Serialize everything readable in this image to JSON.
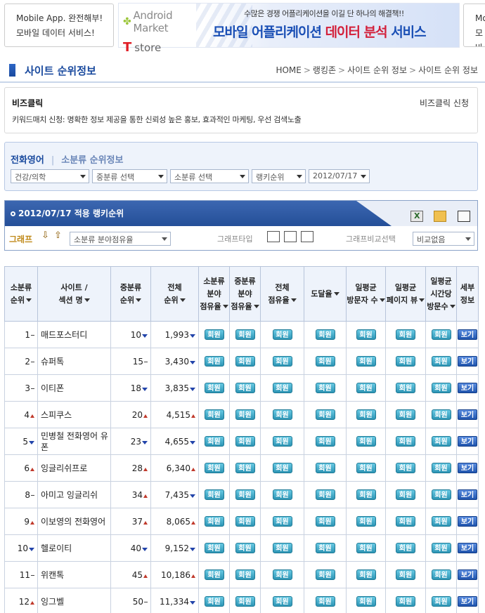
{
  "top_ads": {
    "left": {
      "line1": "Mobile App. 완전해부!",
      "line2": "모바일 데이터 서비스!"
    },
    "banner": {
      "brand1": "Android Market",
      "brand2_logo": "T",
      "brand2": "store",
      "subtitle": "수많은 경쟁 어플리케이션을 이길 단 하나의 해결책!!",
      "headline_a": "모바일 어플리케이션 ",
      "headline_b": "데이터 분석",
      "headline_c": " 서비스"
    },
    "right": {
      "line1": "Mob",
      "line2": "모바"
    }
  },
  "page_title": "사이트 순위정보",
  "breadcrumb": [
    "HOME",
    "랭킹존",
    "사이트 순위 정보",
    "사이트 순위 정보"
  ],
  "breadcrumb_sep": ">",
  "info": {
    "title": "비즈클릭",
    "link": "비즈클릭 신청",
    "desc": "키워드매치 신청: 명확한 정보 제공을 통한 신뢰성 높은 홍보, 효과적인 마케팅, 우선 검색노출"
  },
  "filter": {
    "category": "전화영어",
    "divider": "|",
    "sub_title": "소분류 순위정보",
    "selects": [
      "건강/의학",
      "중분류 선택",
      "소분류 선택",
      "랭키순위",
      "2012/07/17"
    ]
  },
  "ranking": {
    "title": "2012/07/17 적용 랭키순위",
    "graph_label": "그래프",
    "graph_arrow_down": "⇩",
    "graph_arrow_up": "⇧",
    "graph_select": "소분류 분야점유율",
    "graph_type_label": "그래프타입",
    "graph_compare_label": "그래프비교선택",
    "compare_select": "비교없음"
  },
  "table": {
    "headers": [
      [
        "소분류",
        "순위"
      ],
      [
        "사이트 /",
        "섹션 명"
      ],
      [
        "중분류",
        "순위"
      ],
      [
        "전체",
        "순위"
      ],
      [
        "소분류",
        "분야",
        "점유율"
      ],
      [
        "중분류",
        "분야",
        "점유율"
      ],
      [
        "전체",
        "점유율"
      ],
      [
        "도달율"
      ],
      [
        "일평균",
        "방문자 수"
      ],
      [
        "일평균",
        "페이지 뷰"
      ],
      [
        "일평균",
        "시간당",
        "방문수"
      ],
      [
        "세부",
        "정보"
      ]
    ],
    "member_label": "회원",
    "view_label": "보기",
    "rows": [
      {
        "rank": "1",
        "rmark": "eq",
        "name": "매드포스터디",
        "mid": "10",
        "mmark": "dn",
        "total": "1,993",
        "tmark": "dn"
      },
      {
        "rank": "2",
        "rmark": "eq",
        "name": "슈퍼톡",
        "mid": "15",
        "mmark": "eq",
        "total": "3,430",
        "tmark": "dn"
      },
      {
        "rank": "3",
        "rmark": "eq",
        "name": "이티폰",
        "mid": "18",
        "mmark": "dn",
        "total": "3,835",
        "tmark": "dn"
      },
      {
        "rank": "4",
        "rmark": "up",
        "name": "스피쿠스",
        "mid": "20",
        "mmark": "up",
        "total": "4,515",
        "tmark": "up"
      },
      {
        "rank": "5",
        "rmark": "dn",
        "name": "민병철 전화영어 유폰",
        "mid": "23",
        "mmark": "dn",
        "total": "4,655",
        "tmark": "dn"
      },
      {
        "rank": "6",
        "rmark": "up",
        "name": "잉글리쉬프로",
        "mid": "28",
        "mmark": "up",
        "total": "6,340",
        "tmark": "up"
      },
      {
        "rank": "8",
        "rmark": "eq",
        "name": "아미고 잉글리쉬",
        "mid": "34",
        "mmark": "up",
        "total": "7,435",
        "tmark": "dn"
      },
      {
        "rank": "9",
        "rmark": "up",
        "name": "이보영의 전화영어",
        "mid": "37",
        "mmark": "up",
        "total": "8,065",
        "tmark": "up"
      },
      {
        "rank": "10",
        "rmark": "dn",
        "name": "헬로이티",
        "mid": "40",
        "mmark": "dn",
        "total": "9,152",
        "tmark": "dn"
      },
      {
        "rank": "11",
        "rmark": "eq",
        "name": "위캔톡",
        "mid": "45",
        "mmark": "up",
        "total": "10,186",
        "tmark": "up"
      },
      {
        "rank": "12",
        "rmark": "up",
        "name": "잉그벨",
        "mid": "50",
        "mmark": "eq",
        "total": "11,334",
        "tmark": "dn"
      }
    ]
  },
  "colors": {
    "brand_blue": "#1a4a9e",
    "up": "#c0392b",
    "down": "#2244aa",
    "member_btn": "#2d95b5",
    "view_btn": "#1f54ad"
  }
}
